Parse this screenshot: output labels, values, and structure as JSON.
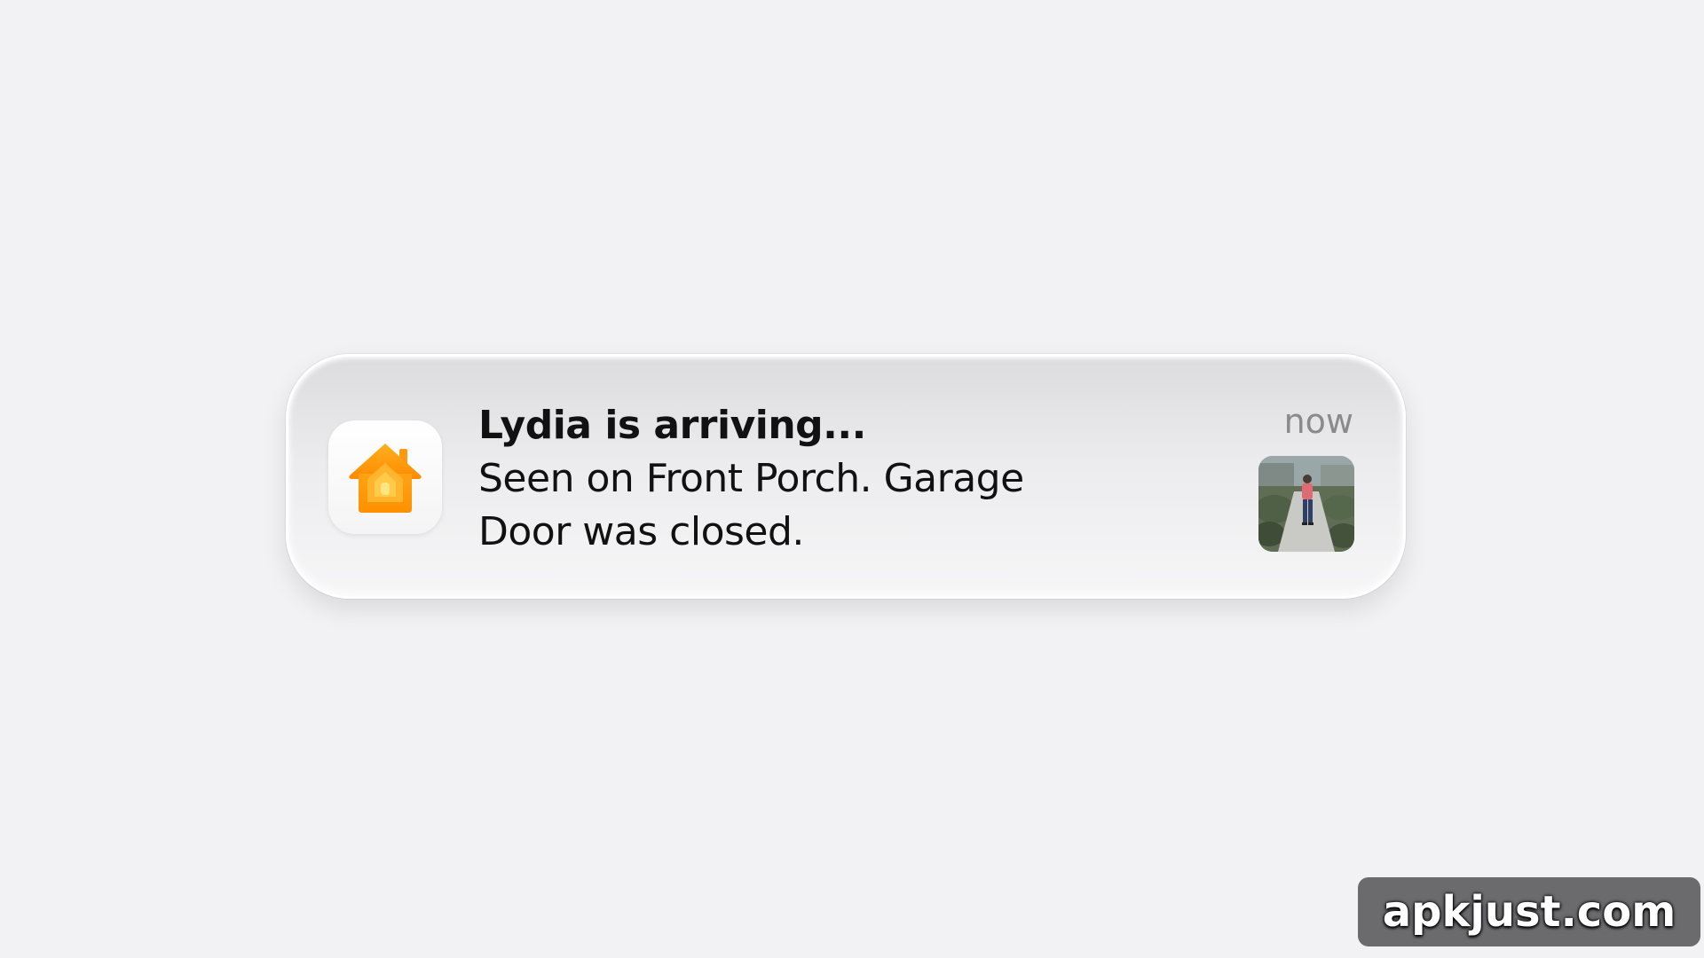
{
  "notification": {
    "title": "Lydia is arriving...",
    "body_line1": "Seen on Front Porch. Garage",
    "body_line2": "Door was closed.",
    "timestamp": "now",
    "app_icon": "home-icon",
    "thumbnail": "camera-snapshot-thumbnail"
  },
  "watermark": {
    "text": "apkjust.com"
  },
  "colors": {
    "background": "#f2f2f4",
    "icon_orange": "#ff9f0a",
    "icon_yellow": "#ffd60a",
    "text_primary": "#111111",
    "text_secondary": "#8a8a8e",
    "watermark_bg": "#6b6b6e"
  }
}
